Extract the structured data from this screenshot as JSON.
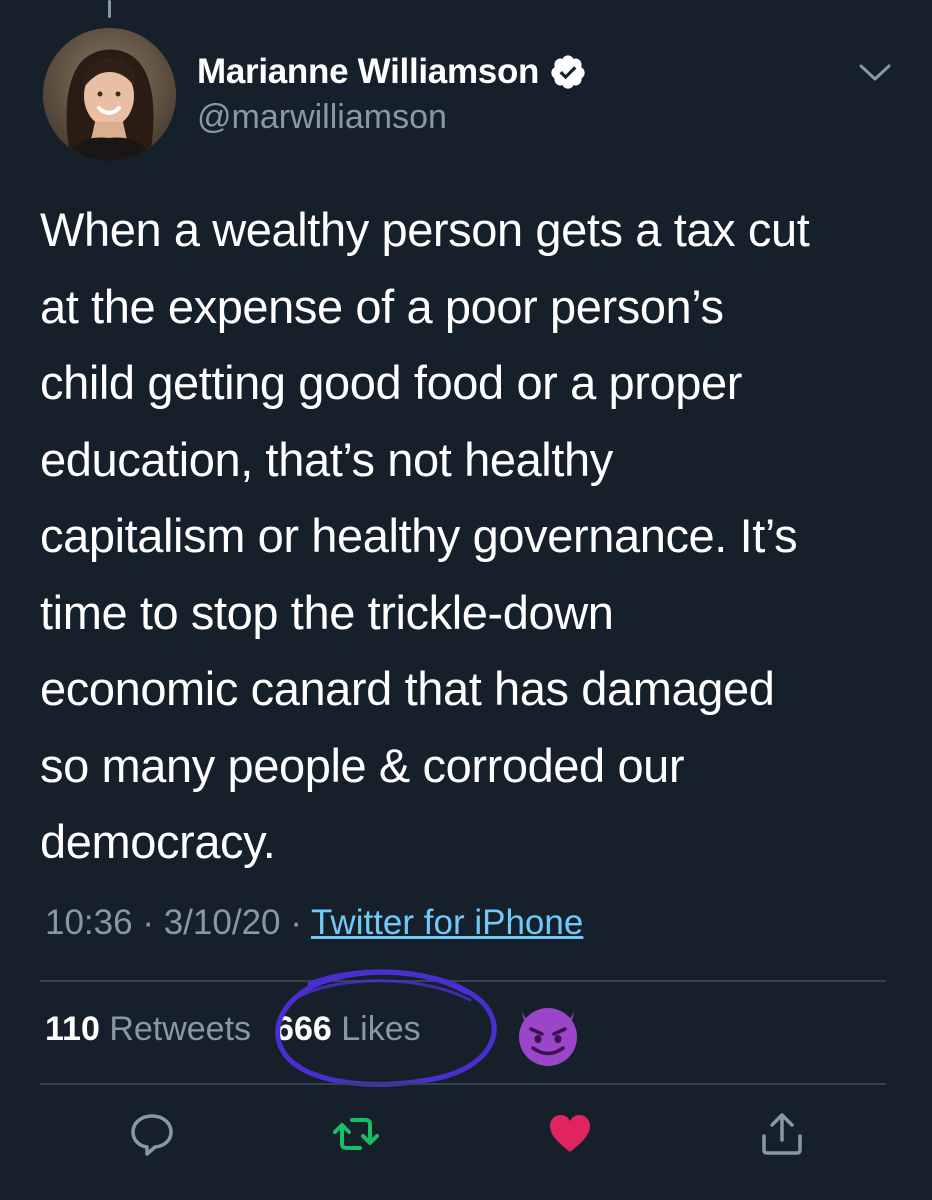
{
  "tweet": {
    "author": {
      "display_name": "Marianne Williamson",
      "handle": "@marwilliamson",
      "verified": true,
      "avatar_icon": "profile-photo"
    },
    "text": "When a wealthy person gets a tax cut\nat the expense of a poor person’s\nchild getting good food or a proper\neducation, that’s not healthy\ncapitalism or healthy governance. It’s\ntime to stop the trickle-down\neconomic canard that has damaged\nso many people & corroded our\ndemocracy.",
    "time": "10:36",
    "separator": "·",
    "date": "3/10/20",
    "source": "Twitter for iPhone",
    "stats": {
      "retweets_count": "110",
      "retweets_label": "Retweets",
      "likes_count": "666",
      "likes_label": "Likes"
    },
    "annotation": {
      "type": "hand-drawn-circle",
      "color": "#4a2fd0",
      "emoji": "smiling-face-with-horns"
    },
    "actions": [
      {
        "name": "reply-icon"
      },
      {
        "name": "retweet-icon",
        "color": "#17bf63"
      },
      {
        "name": "like-icon",
        "color": "#e0245e"
      },
      {
        "name": "share-icon"
      }
    ]
  },
  "colors": {
    "background": "#15202b",
    "secondary_text": "#8899a6",
    "link": "#1da1f2",
    "divider": "#38444d"
  }
}
